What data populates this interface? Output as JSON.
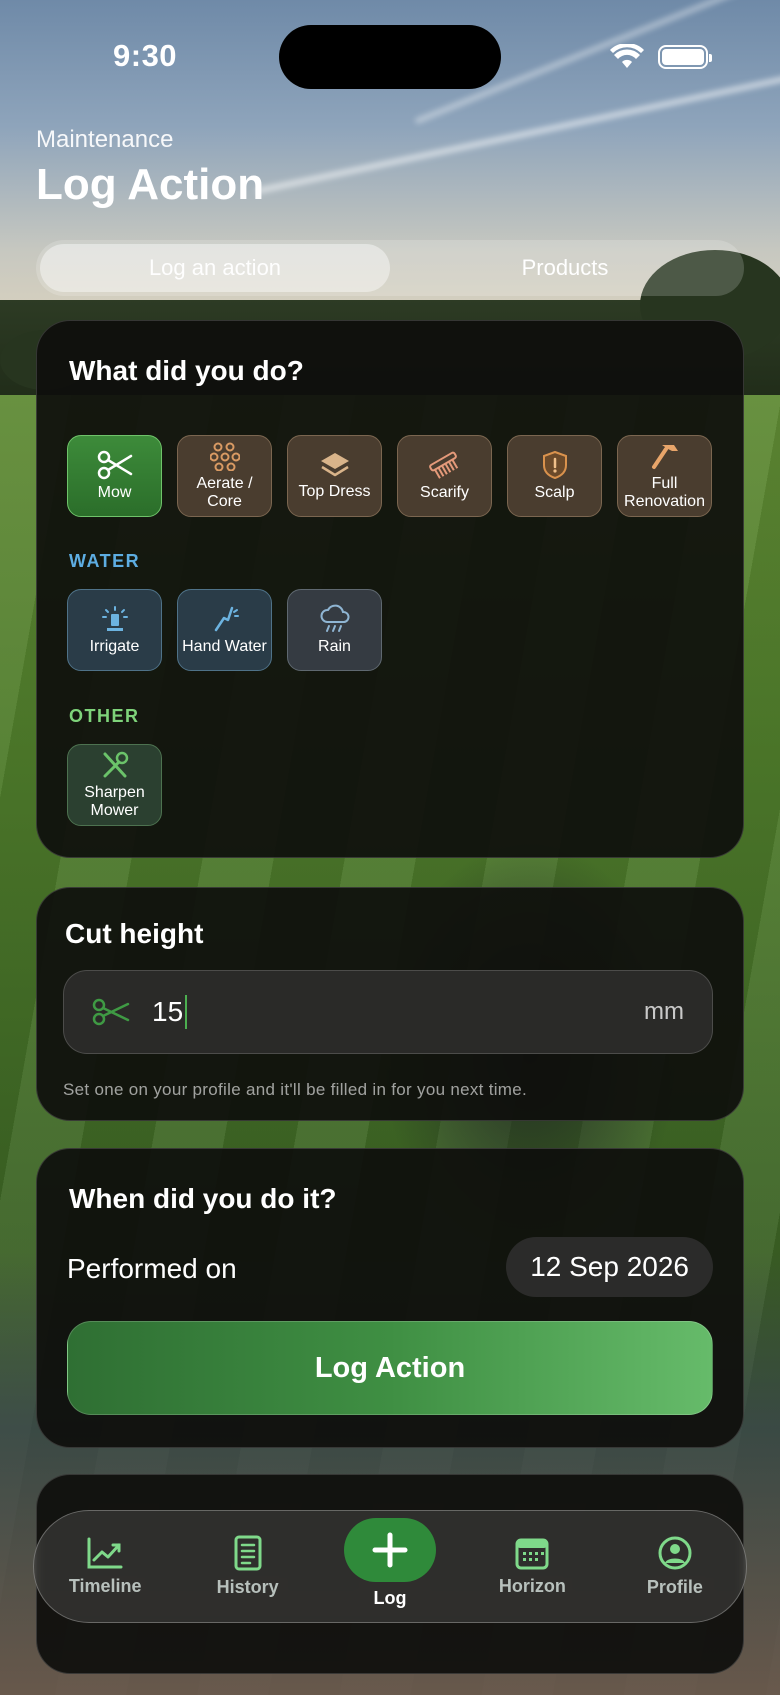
{
  "status_bar": {
    "time": "9:30"
  },
  "header": {
    "eyebrow": "Maintenance",
    "title": "Log Action"
  },
  "segmented": {
    "tabs": [
      {
        "label": "Log an action",
        "active": true
      },
      {
        "label": "Products",
        "active": false
      }
    ]
  },
  "what_card": {
    "title": "What did you do?",
    "cut_actions": [
      {
        "label": "Mow",
        "icon": "scissors-icon",
        "selected": true
      },
      {
        "label": "Aerate / Core",
        "icon": "aerate-icon",
        "selected": false
      },
      {
        "label": "Top Dress",
        "icon": "layers-icon",
        "selected": false
      },
      {
        "label": "Scarify",
        "icon": "comb-icon",
        "selected": false
      },
      {
        "label": "Scalp",
        "icon": "shield-alert-icon",
        "selected": false
      },
      {
        "label": "Full Renovation",
        "icon": "hammer-icon",
        "selected": false
      }
    ],
    "water_label": "WATER",
    "water_actions": [
      {
        "label": "Irrigate",
        "icon": "sprinkler-icon"
      },
      {
        "label": "Hand Water",
        "icon": "hose-icon"
      },
      {
        "label": "Rain",
        "icon": "cloud-rain-icon"
      }
    ],
    "other_label": "OTHER",
    "other_actions": [
      {
        "label": "Sharpen Mower",
        "icon": "tools-icon"
      }
    ]
  },
  "cut_card": {
    "title": "Cut height",
    "value": "15",
    "unit": "mm",
    "hint": "Set one on your profile and it'll be filled in for you next time."
  },
  "when_card": {
    "title": "When did you do it?",
    "row_label": "Performed on",
    "date": "12 Sep 2026",
    "button": "Log Action"
  },
  "tabbar": {
    "items": [
      {
        "label": "Timeline",
        "icon": "chart-line-icon"
      },
      {
        "label": "History",
        "icon": "notebook-icon"
      },
      {
        "label": "Log",
        "icon": "plus-icon",
        "active": true
      },
      {
        "label": "Horizon",
        "icon": "calendar-icon"
      },
      {
        "label": "Profile",
        "icon": "profile-icon"
      }
    ]
  },
  "colors": {
    "accent_green": "#3f8f43",
    "water_label": "#5dade2",
    "other_label": "#7ed37a",
    "tab_icon": "#7fd98a"
  }
}
